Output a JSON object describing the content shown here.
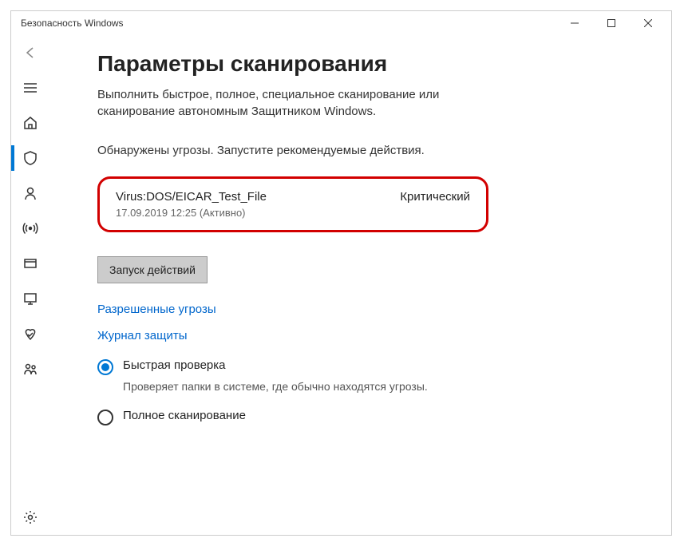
{
  "window": {
    "title": "Безопасность Windows"
  },
  "page": {
    "title": "Параметры сканирования",
    "subtitle": "Выполнить быстрое, полное, специальное сканирование или сканирование автономным Защитником Windows.",
    "alert": "Обнаружены угрозы. Запустите рекомендуемые действия."
  },
  "threat": {
    "name": "Virus:DOS/EICAR_Test_File",
    "severity": "Критический",
    "timestamp": "17.09.2019 12:25 (Активно)"
  },
  "actions": {
    "run": "Запуск действий",
    "allowed": "Разрешенные угрозы",
    "history": "Журнал защиты"
  },
  "scan": {
    "quick": {
      "label": "Быстрая проверка",
      "desc": "Проверяет папки в системе, где обычно находятся угрозы."
    },
    "full": {
      "label": "Полное сканирование"
    }
  }
}
